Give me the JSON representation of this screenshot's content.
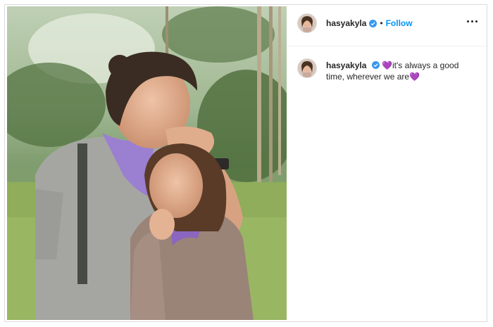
{
  "post": {
    "username": "hasyakyla",
    "follow_label": "Follow",
    "separator": "•",
    "caption_text": "💜it's always a good time, wherever we are💜"
  },
  "photo": {
    "alt": "Couple embracing in a green forest clearing; man in grey t-shirt and purple bandana kisses the forehead of a woman in a brown knit sweater and purple scarf"
  },
  "colors": {
    "accent": "#0095f6",
    "verified": "#3897f0",
    "bandana": "#9b7fd1"
  },
  "icons": {
    "verified": "verified-badge-icon",
    "more": "more-options-icon"
  }
}
